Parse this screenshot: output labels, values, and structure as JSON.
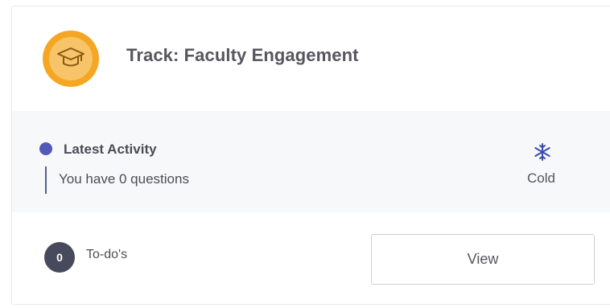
{
  "track": {
    "title": "Track: Faculty Engagement",
    "icon": "graduation-cap-icon",
    "badge_color": "#f5a623"
  },
  "activity": {
    "heading": "Latest Activity",
    "text": "You have 0 questions",
    "dot_color": "#5359b8",
    "temperature": {
      "icon": "snowflake-icon",
      "label": "Cold",
      "icon_color": "#3d4aa8"
    }
  },
  "todos": {
    "count": "0",
    "label": "To-do's",
    "view_label": "View"
  }
}
